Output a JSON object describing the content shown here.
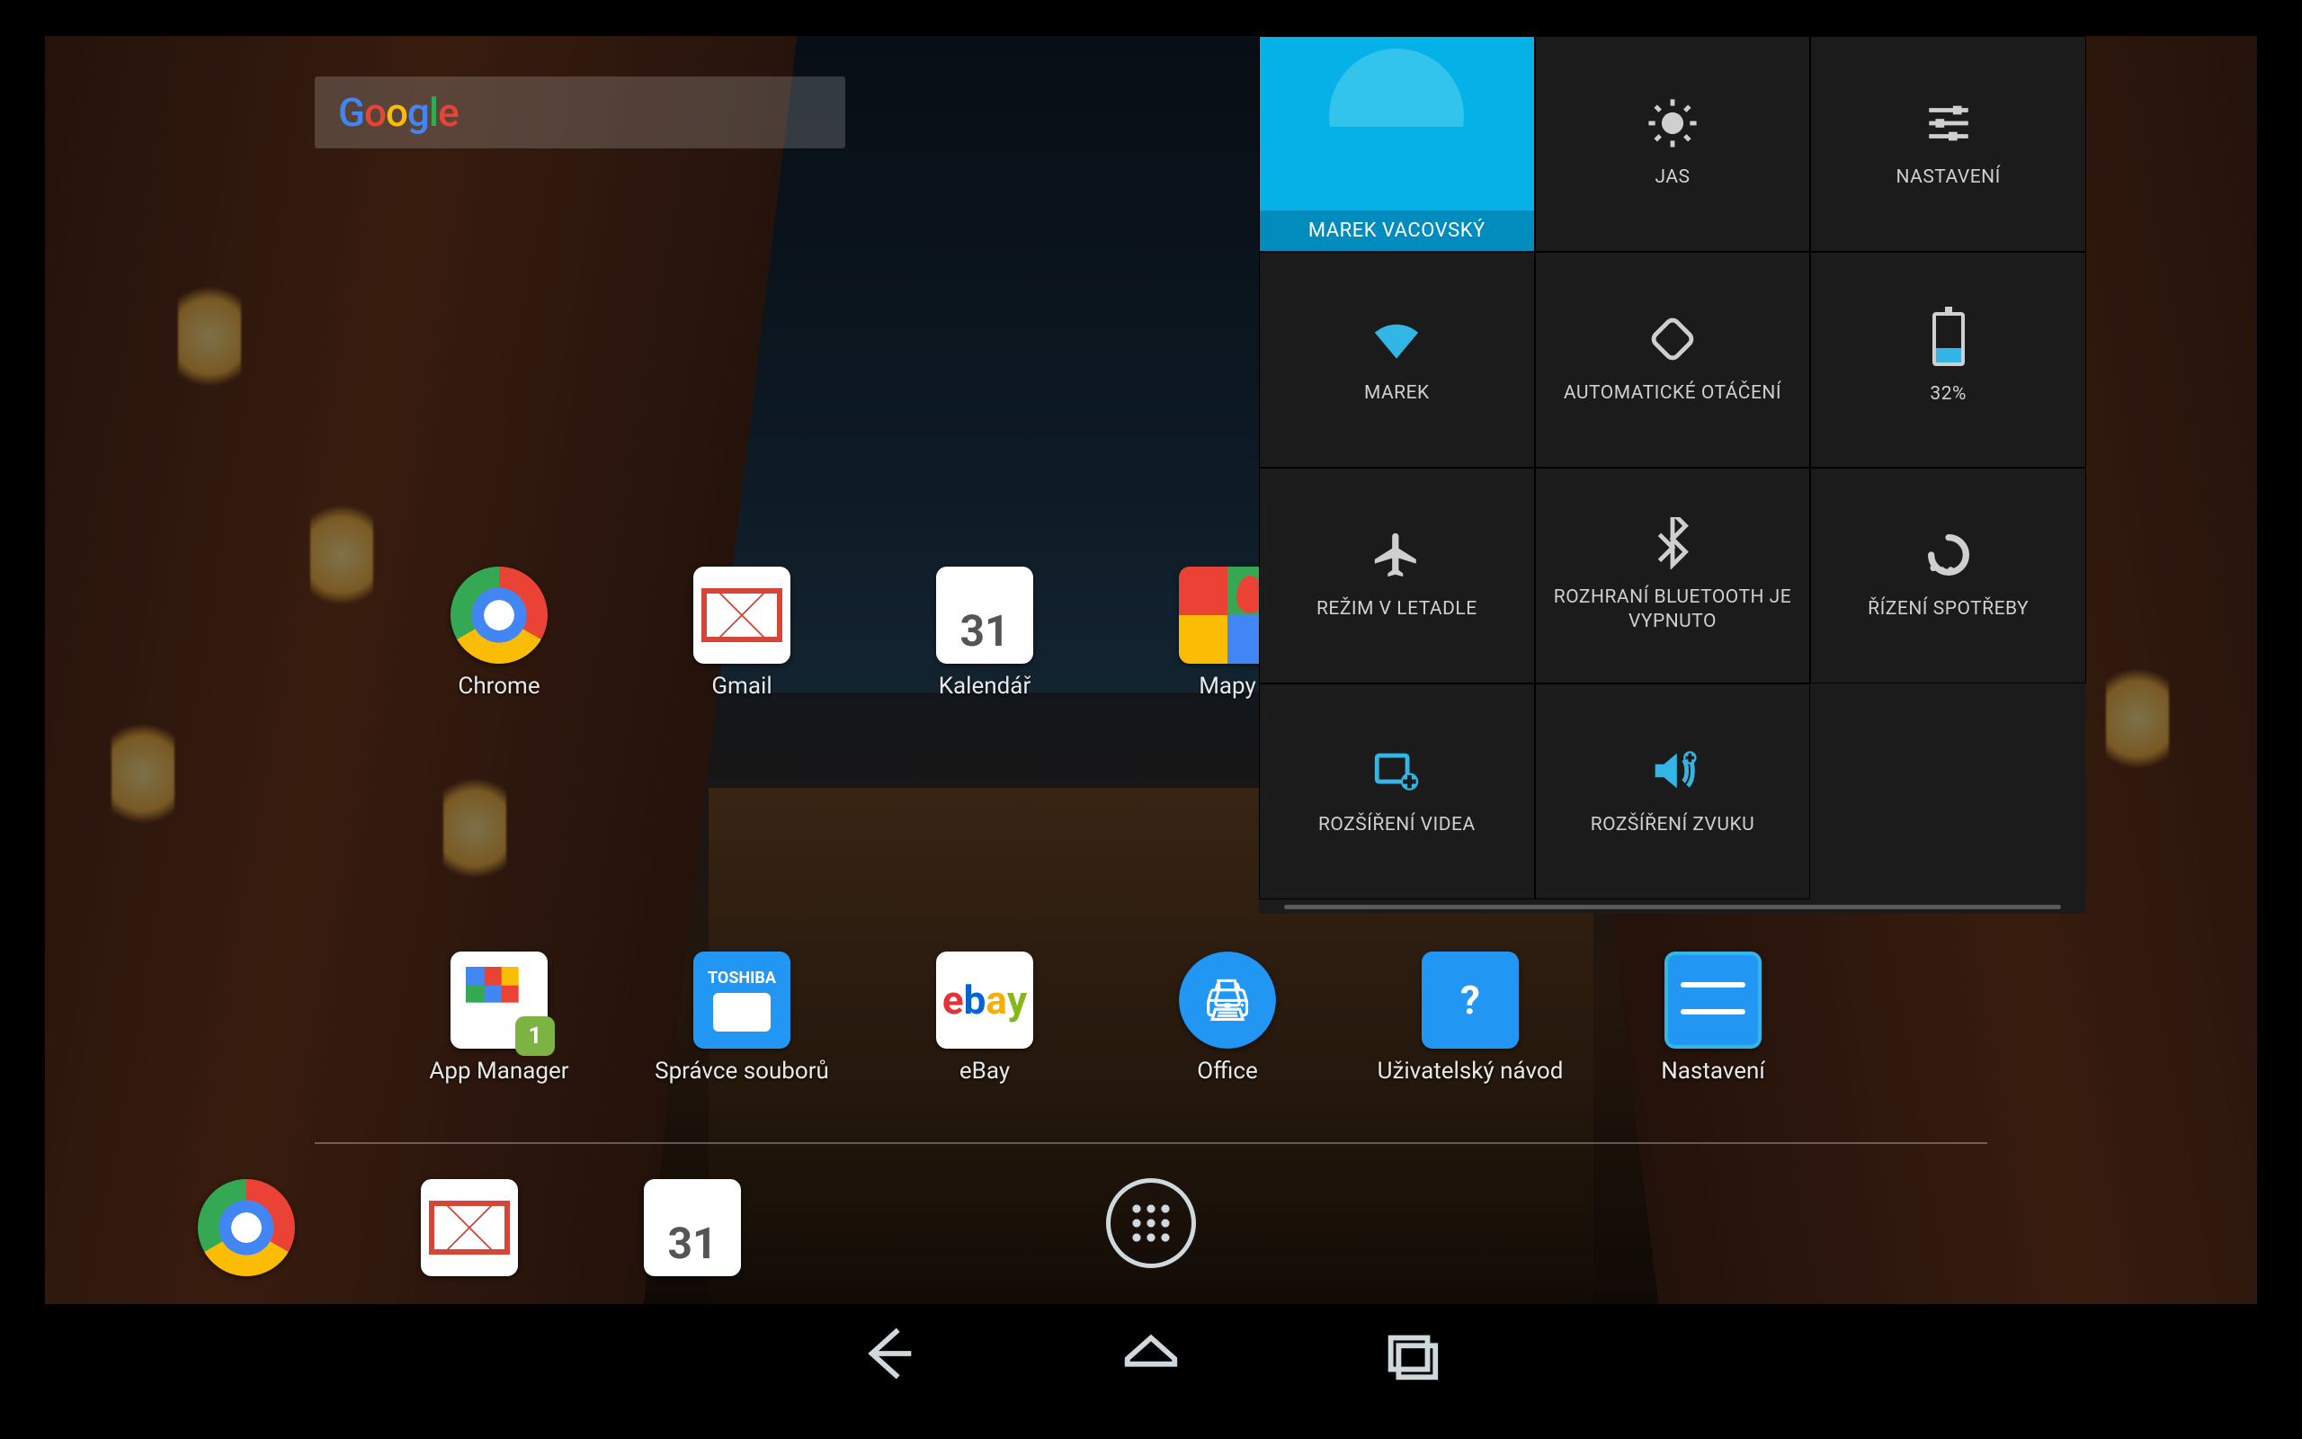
{
  "search": {
    "logo": "Google"
  },
  "apps_row1": [
    {
      "id": "chrome",
      "label": "Chrome"
    },
    {
      "id": "gmail",
      "label": "Gmail"
    },
    {
      "id": "calendar",
      "label": "Kalendář",
      "day": "31"
    },
    {
      "id": "maps",
      "label": "Mapy"
    }
  ],
  "apps_row2": [
    {
      "id": "appmgr",
      "label": "App Manager",
      "badge": "1"
    },
    {
      "id": "files",
      "label": "Správce souborů",
      "brand": "TOSHIBA"
    },
    {
      "id": "ebay",
      "label": "eBay"
    },
    {
      "id": "office",
      "label": "Office"
    },
    {
      "id": "help",
      "label": "Uživatelský návod",
      "glyph": "?"
    },
    {
      "id": "settings",
      "label": "Nastavení"
    }
  ],
  "tray": [
    {
      "id": "tray-chrome"
    },
    {
      "id": "tray-gmail"
    },
    {
      "id": "tray-calendar",
      "day": "31"
    }
  ],
  "quick_settings": {
    "user": {
      "name": "MAREK VACOVSKÝ"
    },
    "tiles": {
      "brightness": {
        "label": "JAS"
      },
      "settings": {
        "label": "NASTAVENÍ"
      },
      "wifi": {
        "label": "MAREK"
      },
      "rotate": {
        "label": "AUTOMATICKÉ OTÁČENÍ"
      },
      "battery": {
        "label": "32%"
      },
      "airplane": {
        "label": "REŽIM V LETADLE"
      },
      "bluetooth": {
        "label": "ROZHRANÍ BLUETOOTH JE VYPNUTO"
      },
      "power": {
        "label": "ŘÍZENÍ SPOTŘEBY"
      },
      "video": {
        "label": "ROZŠÍŘENÍ VIDEA"
      },
      "audio": {
        "label": "ROZŠÍŘENÍ ZVUKU"
      }
    }
  }
}
